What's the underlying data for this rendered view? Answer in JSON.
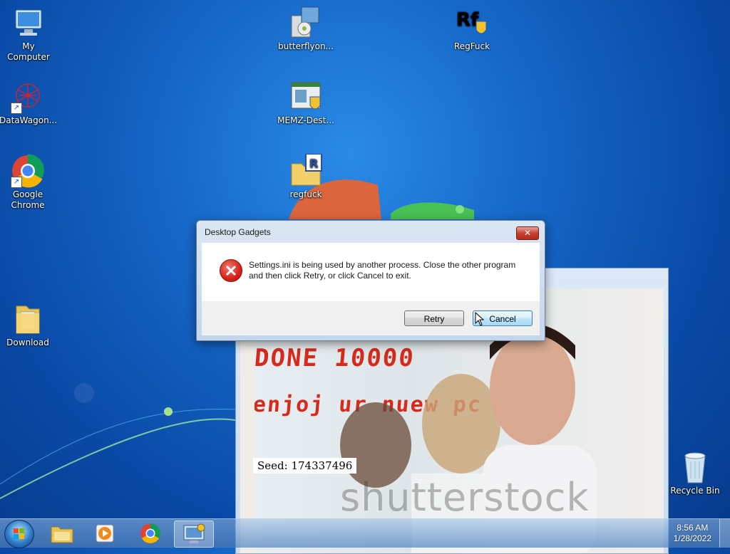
{
  "desktop_icons": [
    {
      "id": "my-computer",
      "label": "My Computer"
    },
    {
      "id": "datawagon",
      "label": "DataWagon..."
    },
    {
      "id": "google-chrome",
      "label": "Google Chrome"
    },
    {
      "id": "download",
      "label": "Download"
    },
    {
      "id": "butterflyon",
      "label": "butterflyon..."
    },
    {
      "id": "memz-dest",
      "label": "MEMZ-Dest..."
    },
    {
      "id": "regfuck-folder",
      "label": "regfuck"
    },
    {
      "id": "regfuck-app",
      "label": "RegFuck"
    },
    {
      "id": "recycle-bin",
      "label": "Recycle Bin"
    }
  ],
  "dialog": {
    "title": "Desktop Gadgets",
    "close_label": "✕",
    "message": "Settings.ini is being used by another process. Close the other program and then click Retry, or click Cancel to exit.",
    "icon": "error-icon",
    "retry_label": "Retry",
    "cancel_label": "Cancel"
  },
  "background_window": {
    "top_text": "DONE 10000",
    "promo_text": "enjoj ur nuew pc",
    "seed_text": "Seed: 174337496",
    "watermark": "shutterstock"
  },
  "taskbar": {
    "time": "8:56 AM",
    "date": "1/28/2022",
    "pinned": [
      "start-orb",
      "file-explorer-icon",
      "media-player-icon",
      "chrome-icon",
      "control-panel-icon"
    ]
  },
  "colors": {
    "accent": "#1566c6",
    "error": "#d3221a",
    "taskbar": "#5a8cc4"
  }
}
